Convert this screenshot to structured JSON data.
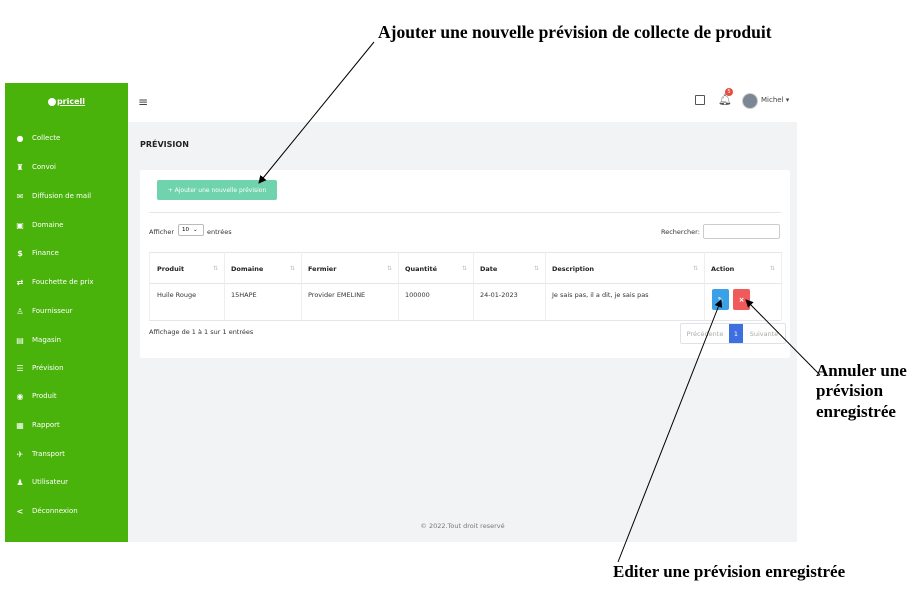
{
  "annotations": {
    "top": "Ajouter une nouvelle prévision de collecte de produit",
    "right": "Annuler une prévision enregistrée",
    "bottom": "Editer une prévision enregistrée"
  },
  "brand": {
    "name": "pricell",
    "logo_letter": "A"
  },
  "sidebar": {
    "items": [
      {
        "label": "Collecte",
        "icon": "circle-icon"
      },
      {
        "label": "Convoi",
        "icon": "vehicle-icon"
      },
      {
        "label": "Diffusion de mail",
        "icon": "mail-icon"
      },
      {
        "label": "Domaine",
        "icon": "domain-icon"
      },
      {
        "label": "Finance",
        "icon": "dollar-icon"
      },
      {
        "label": "Fouchette de prix",
        "icon": "arrows-icon"
      },
      {
        "label": "Fournisseur",
        "icon": "user-icon"
      },
      {
        "label": "Magasin",
        "icon": "store-icon"
      },
      {
        "label": "Prévision",
        "icon": "list-icon"
      },
      {
        "label": "Produit",
        "icon": "product-icon"
      },
      {
        "label": "Rapport",
        "icon": "report-icon"
      },
      {
        "label": "Transport",
        "icon": "transport-icon"
      },
      {
        "label": "Utilisateur",
        "icon": "users-icon"
      },
      {
        "label": "Déconnexion",
        "icon": "share-icon"
      }
    ]
  },
  "topbar": {
    "user_name": "Michel ▾",
    "notification_count": "5"
  },
  "page": {
    "title": "PRÉVISION"
  },
  "toolbar": {
    "add_label": "+ Ajouter une nouvelle prévision"
  },
  "table_controls": {
    "show_label": "Afficher",
    "page_length": "10",
    "entries_label": "entrées",
    "search_label": "Rechercher:"
  },
  "table": {
    "headers": [
      "Produit",
      "Domaine",
      "Fermier",
      "Quantité",
      "Date",
      "Description",
      "Action"
    ],
    "rows": [
      [
        "Huile Rouge",
        "15HAPE",
        "Provider EMELINE",
        "100000",
        "24-01-2023",
        "Je sais pas, il a dit, je sais pas"
      ]
    ]
  },
  "info": "Affichage de 1 à 1 sur 1 entrées",
  "pagination": {
    "prev": "Précédente",
    "current": "1",
    "next": "Suivante"
  },
  "footer": "© 2022.Tout droit reservé",
  "colors": {
    "sidebar": "#49b30b",
    "add_button": "#6fd3ad",
    "edit": "#3aa0e8",
    "delete": "#f05a5a",
    "page_active": "#3e6fe0"
  }
}
